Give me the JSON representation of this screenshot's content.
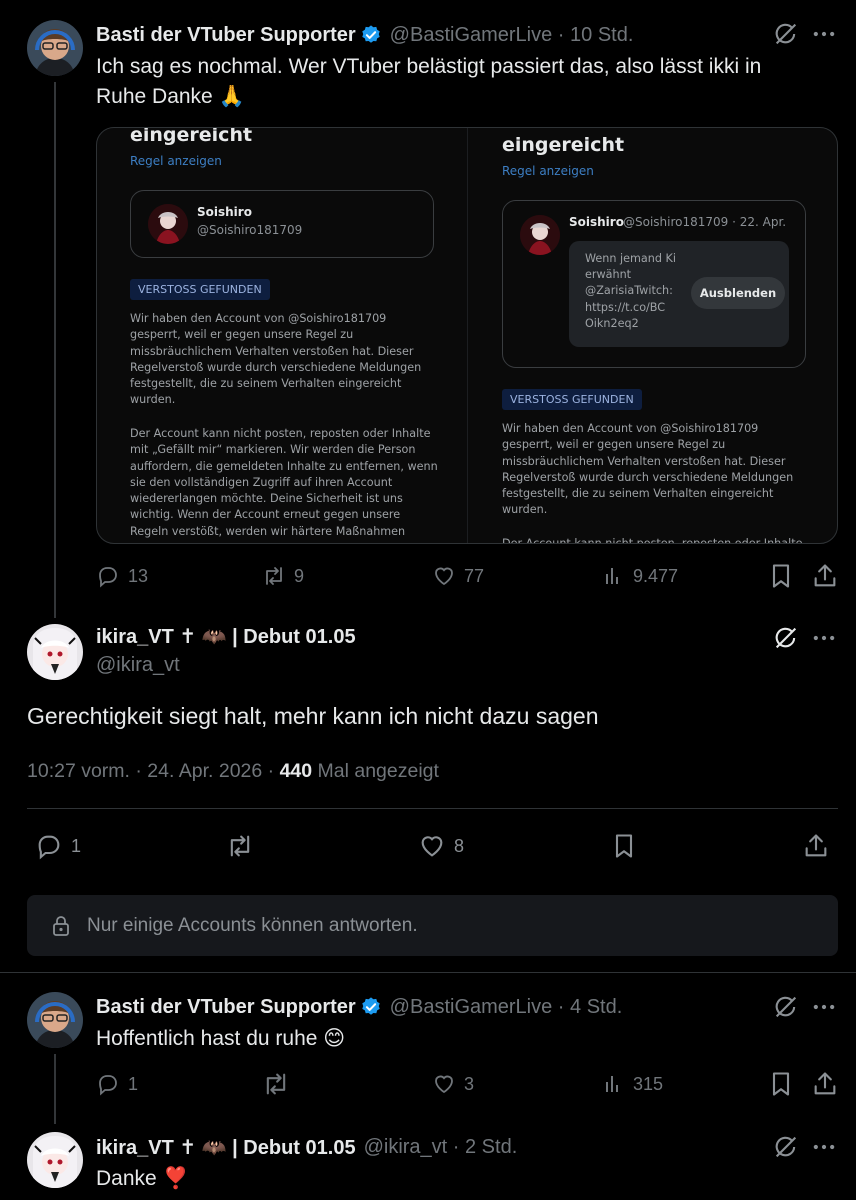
{
  "colors": {
    "background": "#000000",
    "text": "#e7e9ea",
    "muted": "#71767b",
    "verified": "#1d9bf0",
    "divider": "#2f3336"
  },
  "tweet1": {
    "author_name": "Basti der VTuber Supporter",
    "handle_time": "@BastiGamerLive · 10 Std.",
    "text_line1": "Ich sag es nochmal. Wer VTuber belästigt passiert das, also lässt ikki in",
    "text_line2": "Ruhe Danke 🙏",
    "media": {
      "left": {
        "heading": "eingereicht",
        "rule_link": "Regel anzeigen",
        "account_name": "Soishiro",
        "account_handle": "@Soishiro181709",
        "badge": "VERSTOSS GEFUNDEN",
        "para1": "Wir haben den Account von @Soishiro181709 gesperrt, weil er gegen unsere Regel zu missbräuchlichem Verhalten verstoßen hat. Dieser Regelverstoß wurde durch verschiedene Meldungen festgestellt, die zu seinem Verhalten eingereicht wurden.",
        "para2": "Der Account kann nicht posten, reposten oder Inhalte mit „Gefällt mir“ markieren. Wir werden die Person auffordern, die gemeldeten Inhalte zu entfernen, wenn sie den vollständigen Zugriff auf ihren Account wiedererlangen möchte. Deine Sicherheit ist uns wichtig. Wenn der Account erneut gegen unsere Regeln verstößt, werden wir härtere Maßnahmen"
      },
      "right": {
        "heading": "eingereicht",
        "rule_link": "Regel anzeigen",
        "account_name": "Soishiro",
        "account_meta": "@Soishiro181709 · 22. Apr.",
        "hidden_text": "Wenn jemand Ki erwähnt @ZarisiaTwitch: https://t.co/BC Oikn2eq2",
        "hide_button": "Ausblenden",
        "badge": "VERSTOSS GEFUNDEN",
        "para1": "Wir haben den Account von @Soishiro181709 gesperrt, weil er gegen unsere Regel zu missbräuchlichem Verhalten verstoßen hat. Dieser Regelverstoß wurde durch verschiedene Meldungen festgestellt, die zu seinem Verhalten eingereicht wurden.",
        "para2": "Der Account kann nicht posten, reposten oder Inhalte"
      }
    },
    "replies": "13",
    "reposts": "9",
    "likes": "77",
    "views": "9.477"
  },
  "main": {
    "author_name": "ikira_VT ✝ 🦇 | Debut 01.05",
    "handle": "@ikira_vt",
    "text": "Gerechtigkeit siegt halt, mehr kann ich nicht dazu sagen",
    "timestamp": "10:27 vorm. · 24. Apr. 2026 · ",
    "view_count": "440",
    "view_label": " Mal angezeigt",
    "replies": "1",
    "likes": "8",
    "restriction": "Nur einige Accounts können antworten."
  },
  "reply1": {
    "author_name": "Basti der VTuber Supporter",
    "handle_time": "@BastiGamerLive · 4 Std.",
    "text": "Hoffentlich hast du ruhe 😊",
    "replies": "1",
    "likes": "3",
    "views": "315"
  },
  "reply2": {
    "author_name": "ikira_VT ✝ 🦇 | Debut 01.05",
    "handle_time": "@ikira_vt · 2 Std.",
    "text": "Danke ❣️"
  }
}
